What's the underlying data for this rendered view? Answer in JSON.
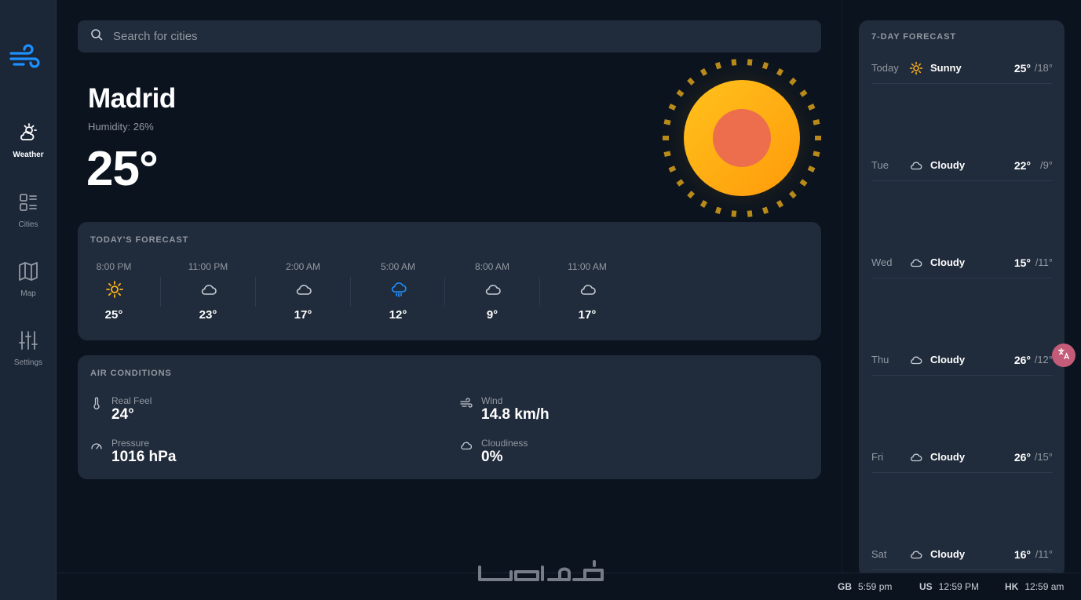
{
  "sidebar": {
    "logo": "wind-logo-icon",
    "items": [
      {
        "label": "Weather",
        "icon": "weather-icon",
        "active": true
      },
      {
        "label": "Cities",
        "icon": "list-icon",
        "active": false
      },
      {
        "label": "Map",
        "icon": "map-icon",
        "active": false
      },
      {
        "label": "Settings",
        "icon": "sliders-icon",
        "active": false
      }
    ]
  },
  "search": {
    "placeholder": "Search for cities",
    "value": ""
  },
  "current": {
    "city": "Madrid",
    "humidity": "Humidity: 26%",
    "temp": "25°",
    "icon": "sun-icon"
  },
  "today_forecast": {
    "title": "TODAY'S FORECAST",
    "hours": [
      {
        "time": "8:00 PM",
        "icon": "sun-icon",
        "temp": "25°"
      },
      {
        "time": "11:00 PM",
        "icon": "cloud-icon",
        "temp": "23°"
      },
      {
        "time": "2:00 AM",
        "icon": "cloud-icon",
        "temp": "17°"
      },
      {
        "time": "5:00 AM",
        "icon": "rain-cloud-icon",
        "temp": "12°"
      },
      {
        "time": "8:00 AM",
        "icon": "cloud-icon",
        "temp": "9°"
      },
      {
        "time": "11:00 AM",
        "icon": "cloud-icon",
        "temp": "17°"
      }
    ]
  },
  "air_conditions": {
    "title": "AIR CONDITIONS",
    "real_feel": {
      "label": "Real Feel",
      "value": "24°",
      "icon": "thermometer-icon"
    },
    "wind": {
      "label": "Wind",
      "value": "14.8 km/h",
      "icon": "wind-icon"
    },
    "pressure": {
      "label": "Pressure",
      "value": "1016 hPa",
      "icon": "gauge-icon"
    },
    "cloudiness": {
      "label": "Cloudiness",
      "value": "0%",
      "icon": "cloud-icon"
    }
  },
  "week_forecast": {
    "title": "7-DAY FORECAST",
    "days": [
      {
        "day": "Today",
        "icon": "sun-icon",
        "condition": "Sunny",
        "high": "25°",
        "low": "/18°"
      },
      {
        "day": "Tue",
        "icon": "cloud-icon",
        "condition": "Cloudy",
        "high": "22°",
        "low": "/9°"
      },
      {
        "day": "Wed",
        "icon": "cloud-icon",
        "condition": "Cloudy",
        "high": "15°",
        "low": "/11°"
      },
      {
        "day": "Thu",
        "icon": "cloud-icon",
        "condition": "Cloudy",
        "high": "26°",
        "low": "/12°"
      },
      {
        "day": "Fri",
        "icon": "cloud-icon",
        "condition": "Cloudy",
        "high": "26°",
        "low": "/15°"
      },
      {
        "day": "Sat",
        "icon": "cloud-icon",
        "condition": "Cloudy",
        "high": "16°",
        "low": "/11°"
      }
    ]
  },
  "footer": {
    "watermark": "خمسات",
    "timezones": [
      {
        "code": "GB",
        "time": "5:59 pm"
      },
      {
        "code": "US",
        "time": "12:59 PM"
      },
      {
        "code": "HK",
        "time": "12:59 am"
      }
    ]
  },
  "colors": {
    "background": "#0b131e",
    "panel": "#202b3b",
    "accent_blue": "#0095ff",
    "sun_orange": "#ffb31a",
    "muted_text": "#9399a2"
  }
}
